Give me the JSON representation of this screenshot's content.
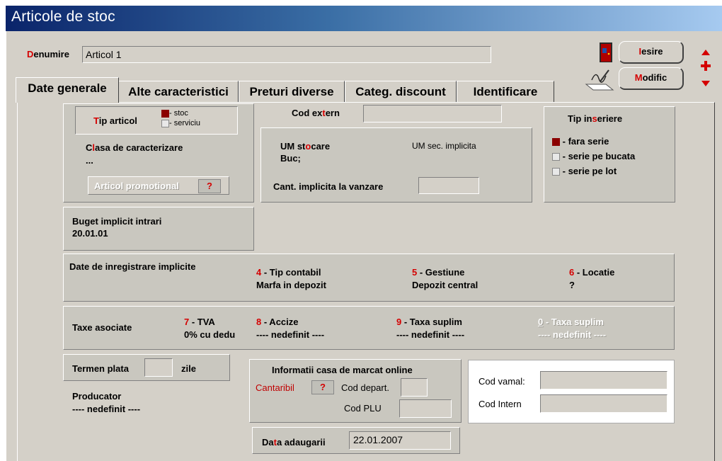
{
  "window": {
    "title": "Articole de stoc"
  },
  "header": {
    "denumire_label_red": "D",
    "denumire_label_rest": "enumire",
    "denumire_value": "Articol 1",
    "iesire_red": "I",
    "iesire_rest": "esire",
    "modific_red": "M",
    "modific_rest": "odific"
  },
  "tabs": [
    {
      "label": "Date generale"
    },
    {
      "label": "Alte caracteristici"
    },
    {
      "label": "Preturi diverse"
    },
    {
      "label": "Categ. discount"
    },
    {
      "label": "Identificare"
    }
  ],
  "tip_articol": {
    "label_red": "T",
    "label_rest": "ip articol",
    "options": [
      {
        "label": "- stoc",
        "checked": true
      },
      {
        "label": "- serviciu",
        "checked": false
      }
    ]
  },
  "clasa": {
    "label_a": "C",
    "label_red": "l",
    "label_rest": "asa de caracterizare",
    "value": "..."
  },
  "promo": {
    "label": "Articol promotional",
    "q": "?"
  },
  "cod_extern": {
    "label_a": "Cod ex",
    "label_red": "t",
    "label_rest": "ern",
    "value": ""
  },
  "um": {
    "stocare_a": "UM st",
    "stocare_red": "o",
    "stocare_rest": "care",
    "stocare_value": "Buc;",
    "sec_label": "UM sec. implicita",
    "cant_label": "Cant. implicita la vanzare",
    "cant_value": ""
  },
  "tip_inseriere": {
    "title_a": "Tip in",
    "title_red": "s",
    "title_rest": "eriere",
    "options": [
      {
        "label": "- fara serie",
        "checked": true
      },
      {
        "label": "- serie pe bucata",
        "checked": false
      },
      {
        "label": "- serie pe lot",
        "checked": false
      }
    ]
  },
  "buget": {
    "label": "Buget implicit intrari",
    "value": "20.01.01"
  },
  "date_inregistrare": {
    "label": "Date de inregistrare implicite",
    "items": [
      {
        "num": "4",
        "label": " - Tip contabil",
        "value": "Marfa in depozit"
      },
      {
        "num": "5",
        "label": " - Gestiune",
        "value": "Depozit central"
      },
      {
        "num": "6",
        "label": " - Locatie",
        "value": "?"
      }
    ]
  },
  "taxe": {
    "label": "Taxe asociate",
    "items": [
      {
        "num": "7",
        "label": " - TVA",
        "value": "0% cu dedu"
      },
      {
        "num": "8",
        "label": " - Accize",
        "value": "---- nedefinit ----"
      },
      {
        "num": "9",
        "label": " - Taxa suplim",
        "value": "---- nedefinit ----"
      },
      {
        "num": "0",
        "label": " - Taxa suplim",
        "value": "---- nedefinit ----"
      }
    ]
  },
  "termen": {
    "label": "Termen plata",
    "value": "",
    "unit": "zile"
  },
  "producator": {
    "label": "Producator",
    "value": "---- nedefinit ----"
  },
  "casa_marcat": {
    "title": "Informatii casa de marcat online",
    "cantaribil": "Cantaribil",
    "q": "?",
    "cod_depart": "Cod depart.",
    "cod_plu": "Cod PLU"
  },
  "data_adaugarii": {
    "label_a": "Da",
    "label_red": "t",
    "label_rest": "a adaugarii",
    "value": "22.01.2007"
  },
  "coduri": {
    "cod_vamal": "Cod vamal:",
    "cod_intern": "Cod Intern"
  }
}
